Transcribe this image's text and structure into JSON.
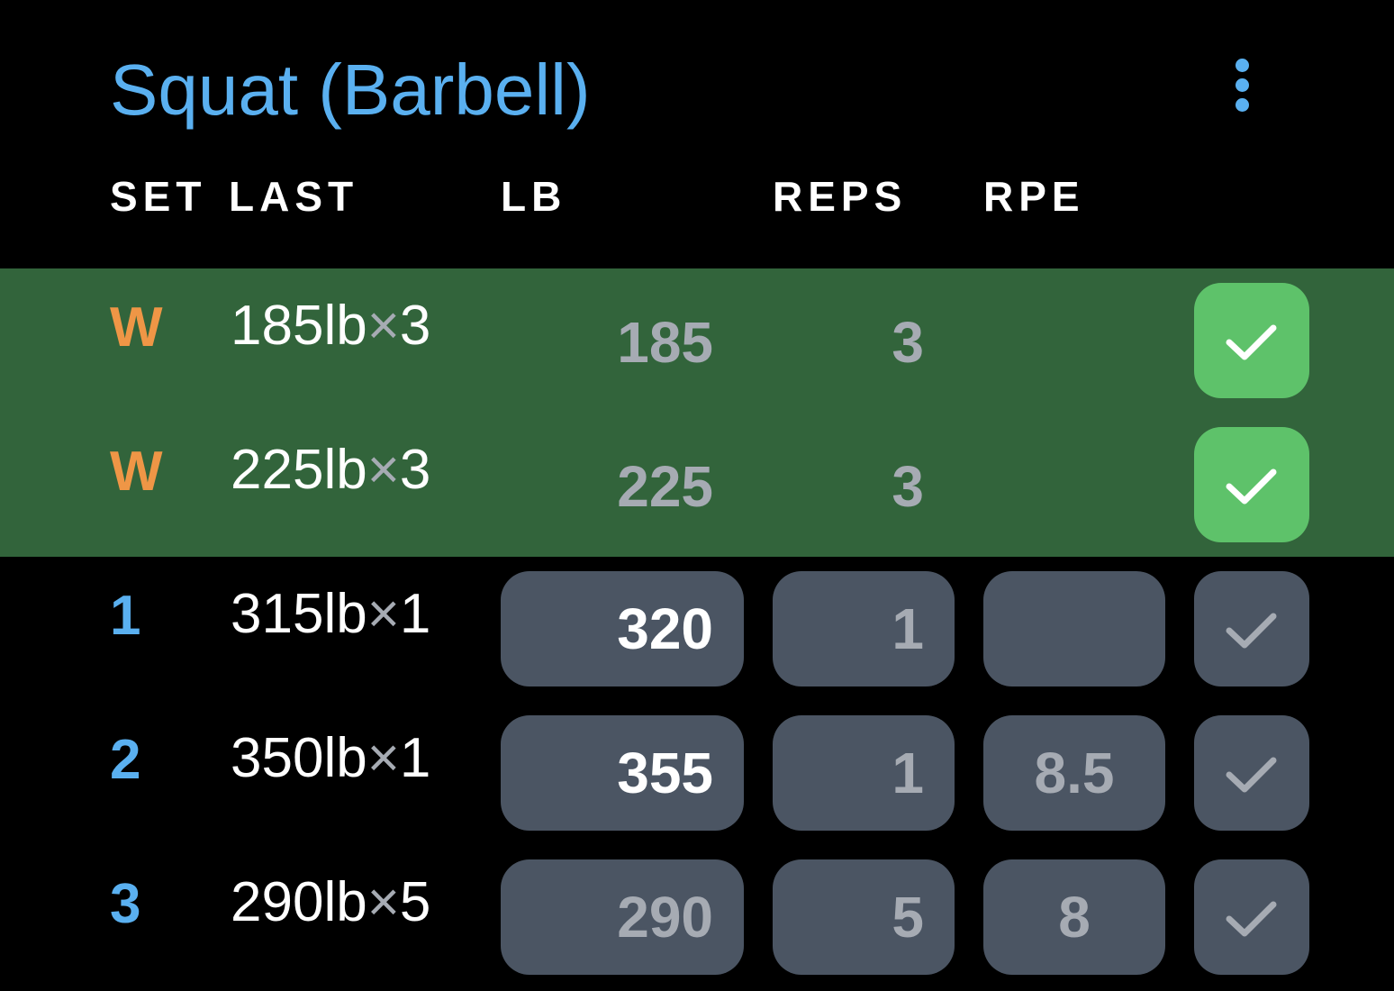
{
  "exercise": {
    "title": "Squat (Barbell)",
    "more_icon": "more-vertical-icon"
  },
  "columns": {
    "set": "SET",
    "last": "LAST",
    "weight": "LB",
    "reps": "REPS",
    "rpe": "RPE"
  },
  "colors": {
    "accent": "#5ab0f0",
    "warmup": "#ef9646",
    "completed_row": "#32643b",
    "completed_check": "#5ec26a",
    "input_bg": "#4b5563",
    "muted_text": "#a6abb3"
  },
  "sets": [
    {
      "set": "W",
      "type": "warmup",
      "last_weight": "185lb",
      "last_sep": "×",
      "last_reps": "3",
      "weight": "185",
      "reps": "3",
      "rpe": "",
      "completed": true,
      "check_icon": "checkmark-icon"
    },
    {
      "set": "W",
      "type": "warmup",
      "last_weight": "225lb",
      "last_sep": "×",
      "last_reps": "3",
      "weight": "225",
      "reps": "3",
      "rpe": "",
      "completed": true,
      "check_icon": "checkmark-icon"
    },
    {
      "set": "1",
      "type": "working",
      "last_weight": "315lb",
      "last_sep": "×",
      "last_reps": "1",
      "weight": "320",
      "reps": "1",
      "rpe": "",
      "completed": false,
      "check_icon": "checkmark-icon"
    },
    {
      "set": "2",
      "type": "working",
      "last_weight": "350lb",
      "last_sep": "×",
      "last_reps": "1",
      "weight": "355",
      "reps": "1",
      "rpe": "8.5",
      "completed": false,
      "check_icon": "checkmark-icon"
    },
    {
      "set": "3",
      "type": "working",
      "last_weight": "290lb",
      "last_sep": "×",
      "last_reps": "5",
      "weight": "290",
      "reps": "5",
      "rpe": "8",
      "completed": false,
      "check_icon": "checkmark-icon"
    }
  ]
}
